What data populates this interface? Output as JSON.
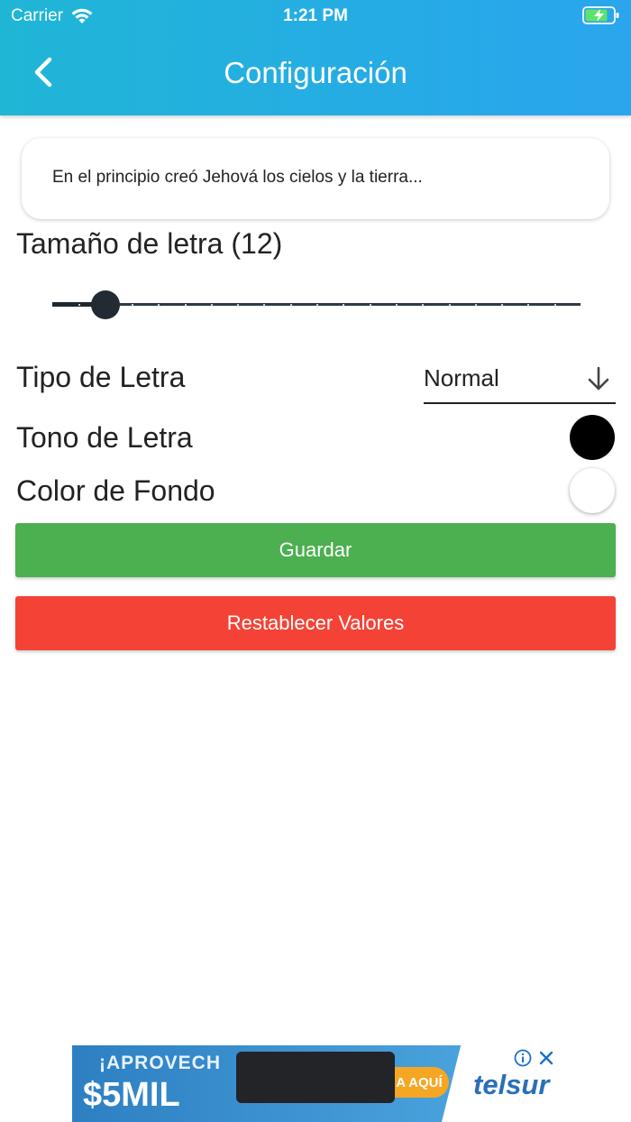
{
  "status_bar": {
    "carrier": "Carrier",
    "time": "1:21 PM"
  },
  "header": {
    "title": "Configuración",
    "back_icon": "chevron-left-icon"
  },
  "preview": {
    "text": "En el principio creó Jehová los cielos y la tierra..."
  },
  "font_size": {
    "label": "Tamaño de letra (12)",
    "slider_fraction": 0.1
  },
  "font_type": {
    "label": "Tipo de Letra",
    "selected": "Normal"
  },
  "font_tone": {
    "label": "Tono de Letra",
    "color": "#000000"
  },
  "background": {
    "label": "Color de Fondo",
    "color": "#ffffff"
  },
  "buttons": {
    "save": "Guardar",
    "reset": "Restablecer Valores"
  },
  "colors": {
    "header_start": "#1fb6d6",
    "header_end": "#2aa5ee",
    "save": "#4caf50",
    "reset": "#f44336"
  },
  "ad": {
    "headline": "¡APROVECH",
    "amount": "$5MIL",
    "cta": "A AQUÍ",
    "brand": "telsur"
  }
}
